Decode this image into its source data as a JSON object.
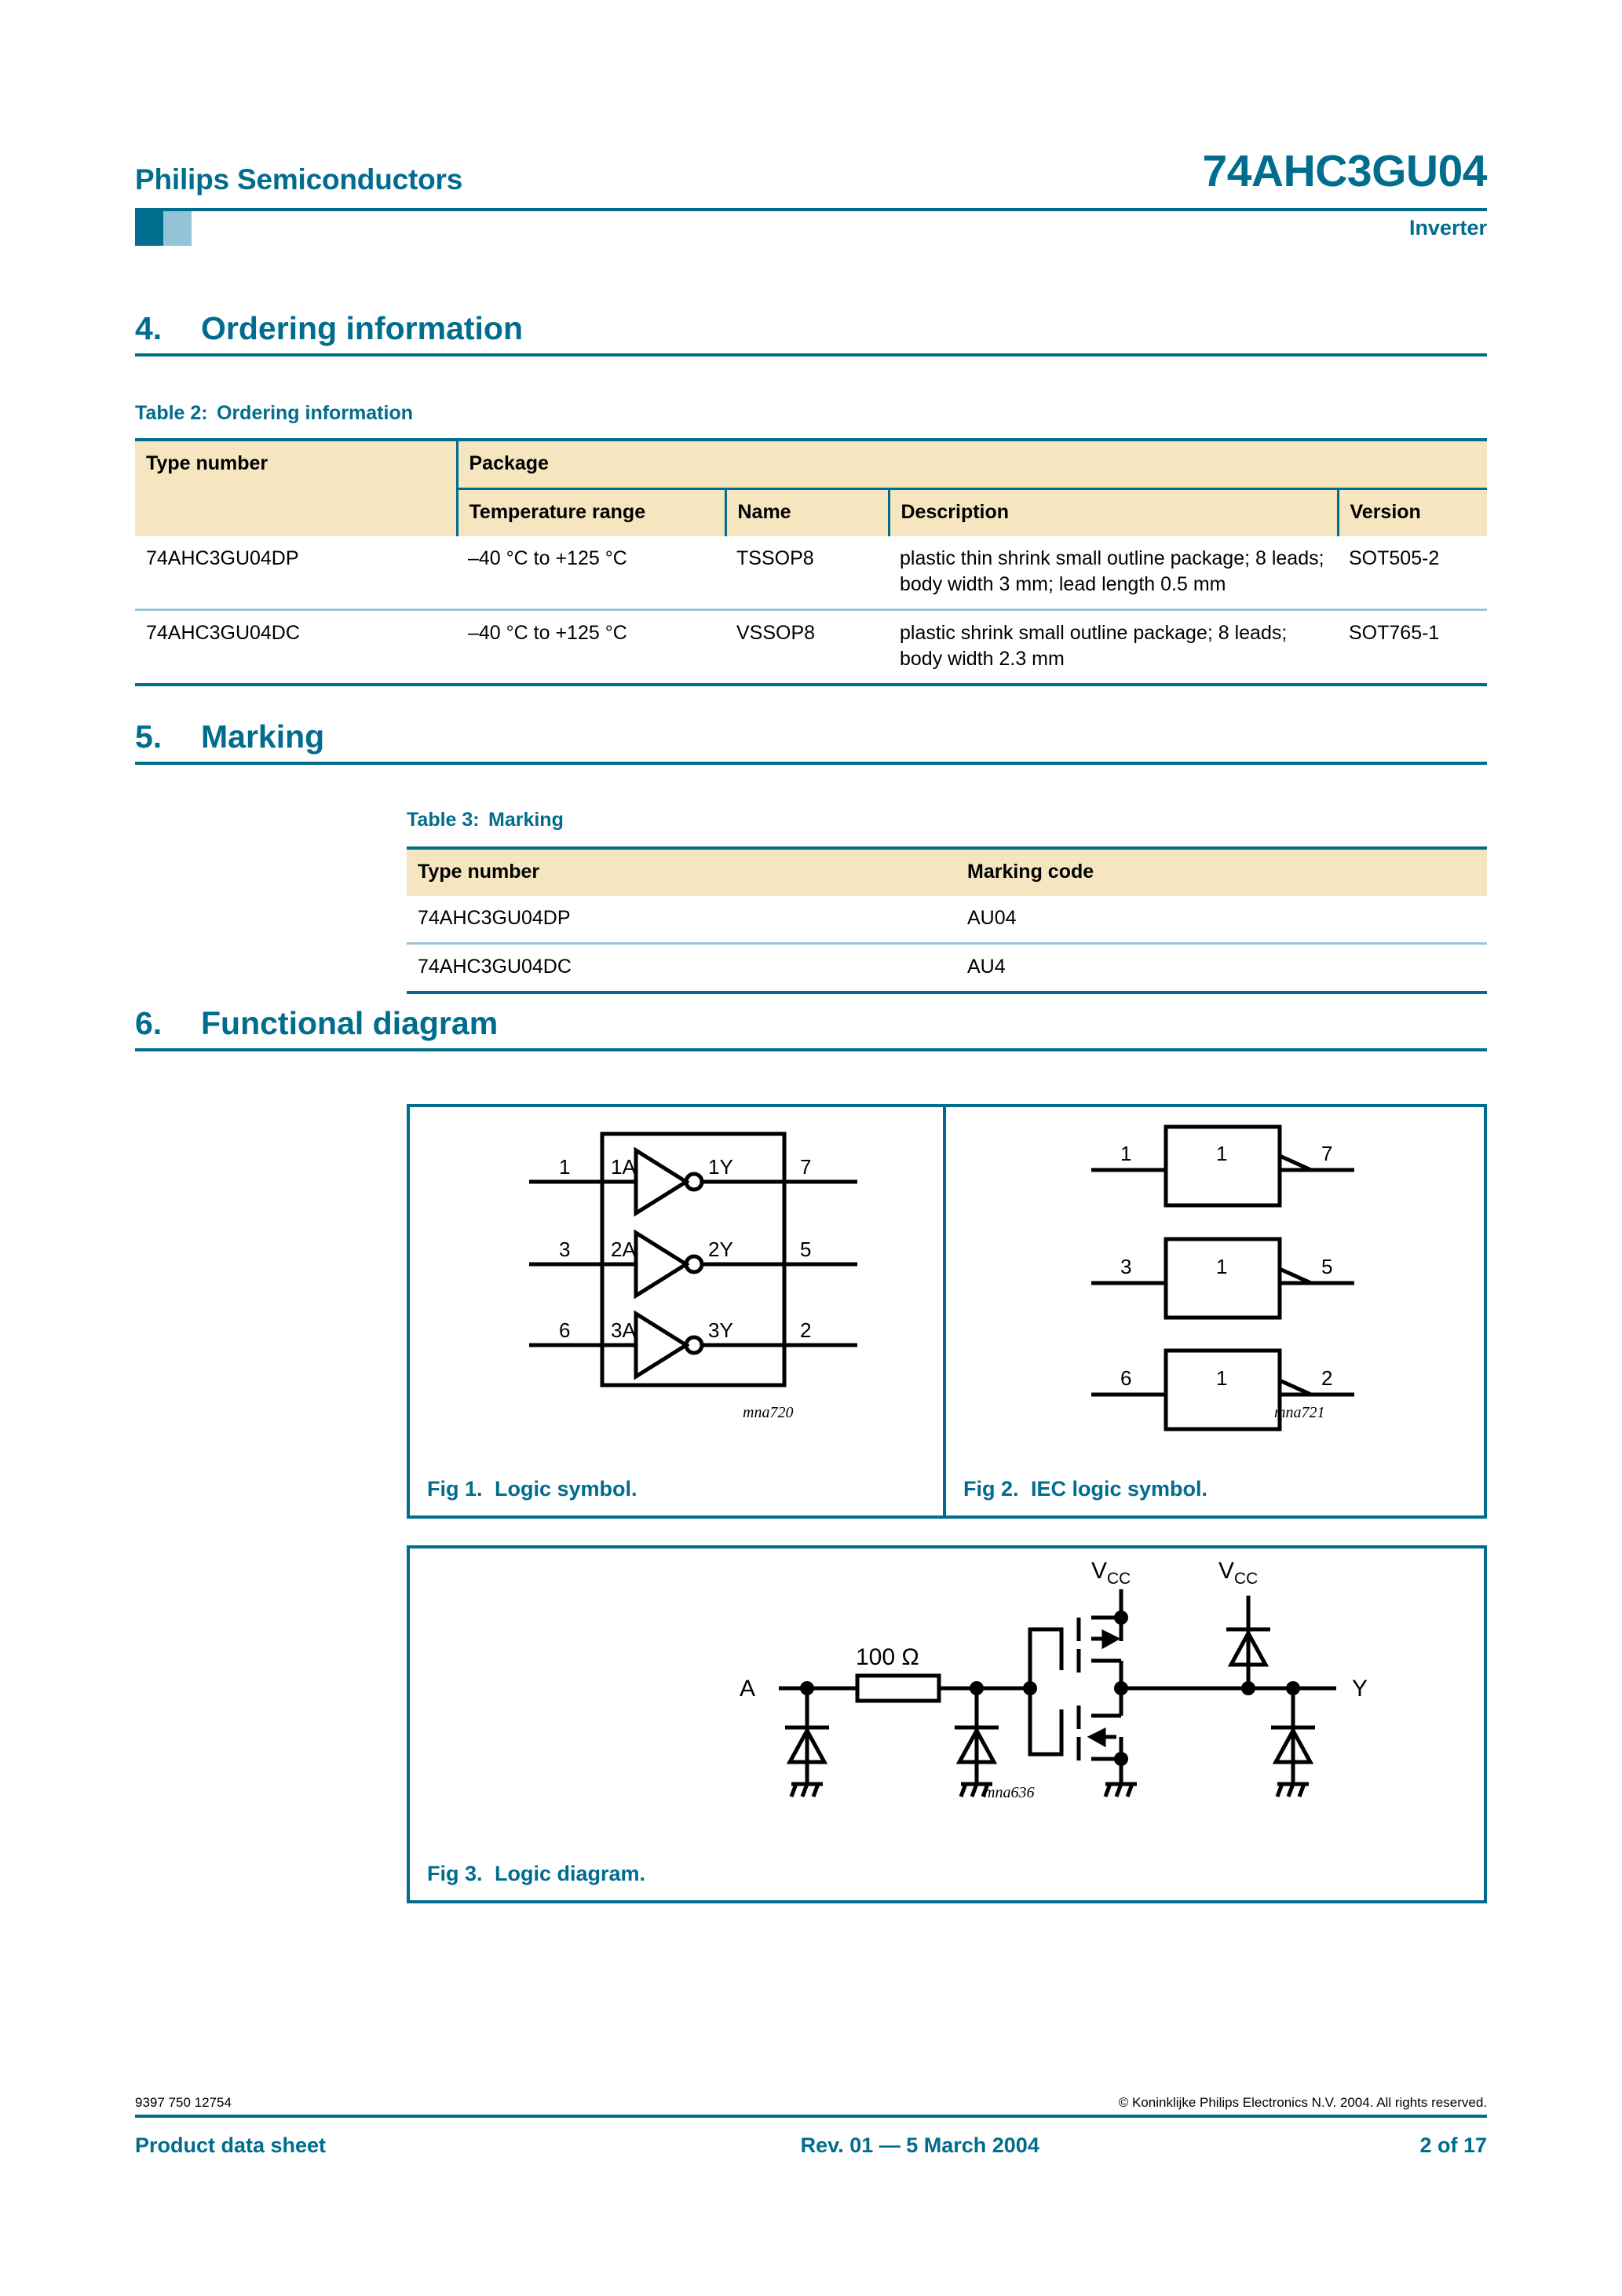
{
  "header": {
    "company": "Philips Semiconductors",
    "part_number": "74AHC3GU04",
    "subtitle": "Inverter",
    "accent_color": "#006C8E",
    "swatch_light_color": "#94C3D8"
  },
  "sections": {
    "ordering": {
      "number": "4.",
      "title": "Ordering information"
    },
    "marking": {
      "number": "5.",
      "title": "Marking"
    },
    "functional": {
      "number": "6.",
      "title": "Functional diagram"
    }
  },
  "table2": {
    "caption_label": "Table 2:",
    "caption_title": "Ordering information",
    "header_group": {
      "type_number": "Type number",
      "package": "Package"
    },
    "subheaders": [
      "Temperature range",
      "Name",
      "Description",
      "Version"
    ],
    "rows": [
      {
        "type_number": "74AHC3GU04DP",
        "temperature_range": "–40 °C to +125 °C",
        "name": "TSSOP8",
        "description": "plastic thin shrink small outline package; 8 leads; body width 3 mm; lead length 0.5 mm",
        "version": "SOT505-2"
      },
      {
        "type_number": "74AHC3GU04DC",
        "temperature_range": "–40 °C to +125 °C",
        "name": "VSSOP8",
        "description": "plastic shrink small outline package; 8 leads; body width 2.3 mm",
        "version": "SOT765-1"
      }
    ]
  },
  "table3": {
    "caption_label": "Table 3:",
    "caption_title": "Marking",
    "headers": [
      "Type number",
      "Marking code"
    ],
    "rows": [
      {
        "type_number": "74AHC3GU04DP",
        "marking_code": "AU04"
      },
      {
        "type_number": "74AHC3GU04DC",
        "marking_code": "AU4"
      }
    ]
  },
  "figures": {
    "fig1": {
      "caption_num": "Fig 1.",
      "caption_text": "Logic symbol.",
      "graphic_id": "mna720",
      "gates": [
        {
          "pin_in": "1",
          "label_in": "1A",
          "label_out": "1Y",
          "pin_out": "7"
        },
        {
          "pin_in": "3",
          "label_in": "2A",
          "label_out": "2Y",
          "pin_out": "5"
        },
        {
          "pin_in": "6",
          "label_in": "3A",
          "label_out": "3Y",
          "pin_out": "2"
        }
      ]
    },
    "fig2": {
      "caption_num": "Fig 2.",
      "caption_text": "IEC logic symbol.",
      "graphic_id": "mna721",
      "blocks": [
        {
          "pin_in": "1",
          "symbol": "1",
          "pin_out": "7"
        },
        {
          "pin_in": "3",
          "symbol": "1",
          "pin_out": "5"
        },
        {
          "pin_in": "6",
          "symbol": "1",
          "pin_out": "2"
        }
      ]
    },
    "fig3": {
      "caption_num": "Fig 3.",
      "caption_text": "Logic diagram.",
      "graphic_id": "mna636",
      "input_label": "A",
      "output_label": "Y",
      "resistor_label": "100 Ω",
      "supply_label_1": "V",
      "supply_sub_1": "CC",
      "supply_label_2": "V",
      "supply_sub_2": "CC"
    }
  },
  "footer": {
    "doc_number": "9397 750 12754",
    "copyright": "© Koninklijke Philips Electronics N.V. 2004. All rights reserved.",
    "doc_type": "Product data sheet",
    "revision": "Rev. 01 — 5 March 2004",
    "page": "2 of 17"
  }
}
